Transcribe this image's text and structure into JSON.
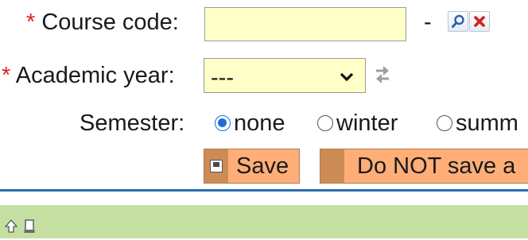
{
  "form": {
    "course_code": {
      "required_mark": "*",
      "label": "Course code:",
      "value": "",
      "separator": "-"
    },
    "academic_year": {
      "required_mark": "*",
      "label": "Academic year:",
      "selected": "---"
    },
    "semester": {
      "label": "Semester:",
      "options": [
        {
          "label": "none",
          "checked": true
        },
        {
          "label": "winter",
          "checked": false
        },
        {
          "label": "summ",
          "checked": false
        }
      ]
    },
    "buttons": {
      "save_label": "Save",
      "dont_save_label": "Do NOT save a"
    }
  },
  "icons": {
    "search": "search-icon",
    "clear": "clear-icon",
    "swap": "swap-arrows-icon",
    "save": "floppy-icon",
    "up": "up-arrow-icon",
    "bookmark": "bookmark-icon"
  },
  "colors": {
    "input_bg": "#ffffc8",
    "button_orange": "#ffae78",
    "button_strip": "#cd8c55",
    "divider": "#2b6cb0",
    "bottom_bar": "#c5dfa2",
    "required": "#dd2222",
    "radio_selected": "#1a6fd6"
  }
}
